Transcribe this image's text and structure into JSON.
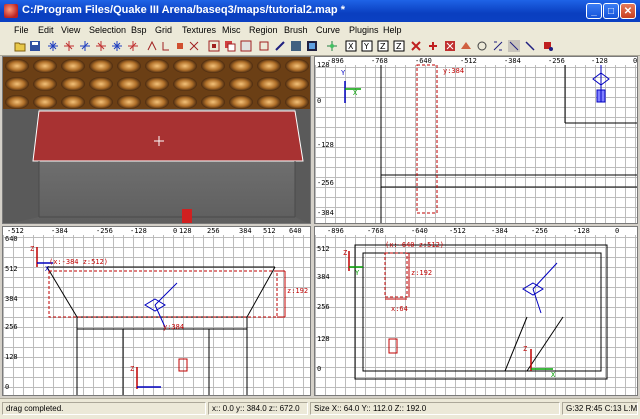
{
  "window": {
    "title": "C:/Program Files/Quake III Arena/baseq3/maps/tutorial2.map *",
    "minimize": "_",
    "maximize": "□",
    "close": "✕"
  },
  "menu": [
    "File",
    "Edit",
    "View",
    "Selection",
    "Bsp",
    "Grid",
    "Textures",
    "Misc",
    "Region",
    "Brush",
    "Curve",
    "Plugins",
    "Help"
  ],
  "toolbar_icons": [
    "open-file-icon",
    "save-icon",
    "x-axis-flip-icon",
    "x-axis-rotate-icon",
    "y-axis-flip-icon",
    "y-axis-rotate-icon",
    "z-axis-flip-icon",
    "z-axis-rotate-icon",
    "complete-tall-icon",
    "size-tall-icon",
    "partial-tall-icon",
    "touching-icon",
    "inside-icon",
    "csg-subtract-icon",
    "csg-merge-icon",
    "hollow-icon",
    "clipper-icon",
    "change-views-icon",
    "texture-lock-icon",
    "camera-icon",
    "view-x-icon",
    "view-y-icon",
    "view-z-icon",
    "show-entities-icon",
    "hide-selected-icon",
    "cubic-clip-icon",
    "redisperse-icon",
    "patch-icon",
    "drag-edges-icon",
    "drag-vertices-icon",
    "region-icon"
  ],
  "views": {
    "top_right": {
      "ruler_x": [
        "-896",
        "-768",
        "-640",
        "-512",
        "-384",
        "-256",
        "-128",
        "0"
      ],
      "ruler_y": [
        "128",
        "0",
        "-128",
        "-256",
        "-384"
      ],
      "label_y": "y:384",
      "axis_y": "Y",
      "axis_x": "X"
    },
    "bottom_left": {
      "ruler_x": [
        "-512",
        "-384",
        "-256",
        "-128",
        "0",
        "128",
        "256",
        "384",
        "512",
        "640"
      ],
      "ruler_y": [
        "640",
        "512",
        "384",
        "256",
        "128",
        "0"
      ],
      "label_coords": "(x:-384 z:512)",
      "label_z": "z:192",
      "label_y": "y:384",
      "axis_z": "Z",
      "axis_x": "X",
      "axis_z2": "Z"
    },
    "bottom_right": {
      "ruler_x": [
        "-896",
        "-768",
        "-640",
        "-512",
        "-384",
        "-256",
        "-128",
        "0"
      ],
      "ruler_y": [
        "512",
        "384",
        "256",
        "128",
        "0"
      ],
      "label_coords": "(x:-640 z:512)",
      "label_z": "z:192",
      "label_x": "x:64",
      "axis_z": "Z",
      "axis_y": "Y",
      "axis_z2": "Z",
      "axis_x2": "X"
    }
  },
  "status": {
    "message": "drag completed.",
    "position": "x:: 0.0  y:: 384.0  z:: 672.0",
    "size": "Size X:: 64.0  Y:: 112.0  Z:: 192.0",
    "info": "G:32 R:45 C:13 L:MR"
  },
  "colors": {
    "titlebar": "#0a3fc0",
    "brush_red": "#c00000",
    "grid_line": "#bcbcbc",
    "wall_red": "#a83232"
  }
}
